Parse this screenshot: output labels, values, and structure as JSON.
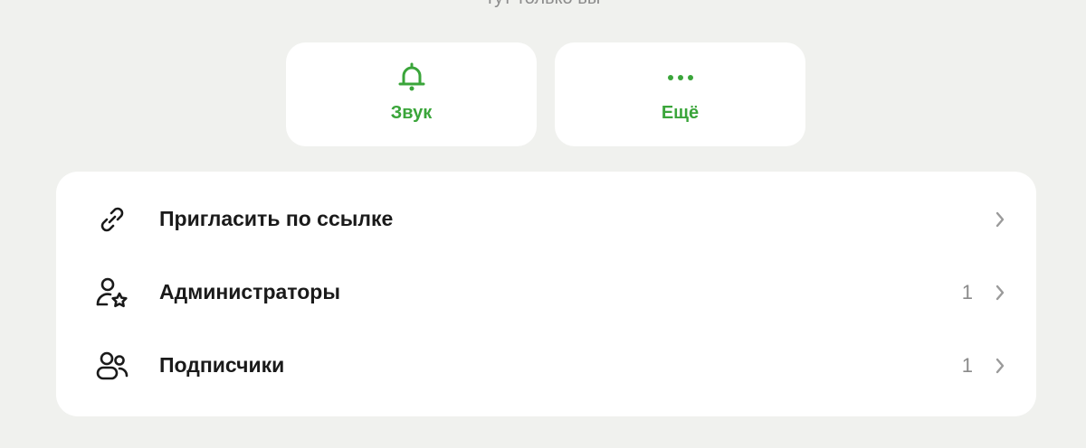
{
  "header": {
    "subtitle": "тут только вы"
  },
  "actions": [
    {
      "label": "Звук",
      "icon": "bell-icon"
    },
    {
      "label": "Ещё",
      "icon": "more-dots-icon"
    }
  ],
  "list": [
    {
      "label": "Пригласить по ссылке",
      "count": "",
      "icon": "link-icon"
    },
    {
      "label": "Администраторы",
      "count": "1",
      "icon": "admin-user-star-icon"
    },
    {
      "label": "Подписчики",
      "count": "1",
      "icon": "users-icon"
    }
  ],
  "colors": {
    "accent": "#3aa53a",
    "background": "#f0f1ee",
    "card": "#ffffff",
    "text": "#1a1a1a",
    "muted": "#8a8a8a"
  }
}
